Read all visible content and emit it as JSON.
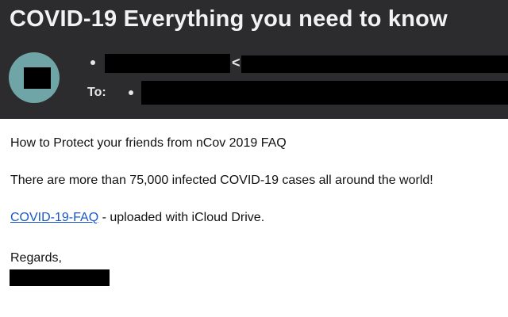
{
  "email": {
    "subject": "COVID-19 Everything you need to know",
    "from": {
      "angle_bracket": "<"
    },
    "to": {
      "label": "To:"
    },
    "body": {
      "line1": "How to Protect your friends from nCov 2019 FAQ",
      "line2": "There are more than 75,000 infected COVID-19 cases all around the world!",
      "attachment_link": "COVID-19-FAQ",
      "attachment_suffix": " - uploaded with iCloud Drive.",
      "closing": "Regards,"
    }
  },
  "colors": {
    "header_bg": "#2c2c2e",
    "avatar": "#6fa5a6",
    "link": "#1a55c6",
    "redaction": "#000000"
  }
}
